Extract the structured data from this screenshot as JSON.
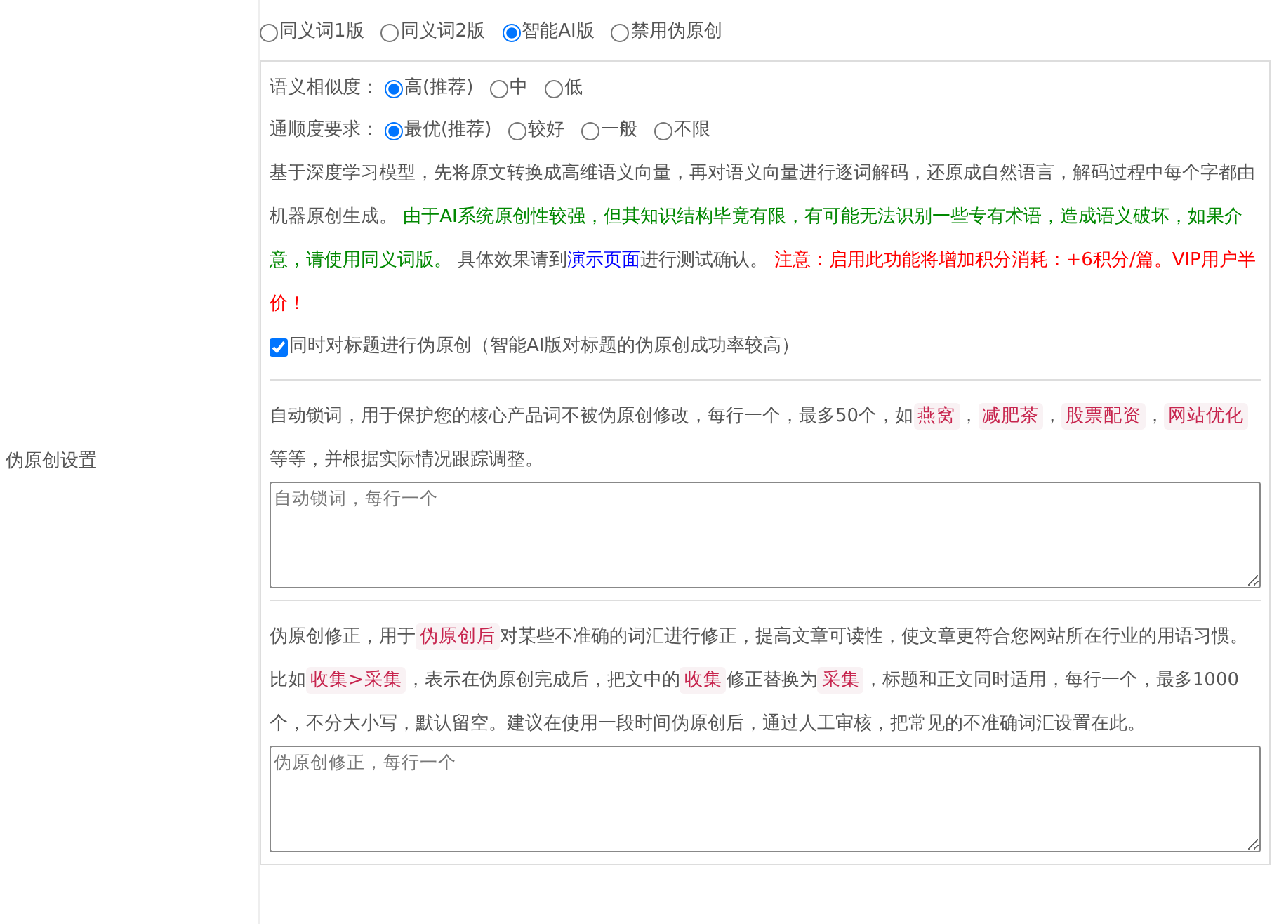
{
  "sidebar": {
    "label": "伪原创设置"
  },
  "modes": [
    {
      "label": "同义词1版",
      "selected": false
    },
    {
      "label": "同义词2版",
      "selected": false
    },
    {
      "label": "智能AI版",
      "selected": true
    },
    {
      "label": "禁用伪原创",
      "selected": false
    }
  ],
  "ai_settings": {
    "similarity": {
      "label": "语义相似度：",
      "options": [
        {
          "label": "高(推荐)",
          "selected": true
        },
        {
          "label": "中",
          "selected": false
        },
        {
          "label": "低",
          "selected": false
        }
      ]
    },
    "fluency": {
      "label": "通顺度要求：",
      "options": [
        {
          "label": "最优(推荐)",
          "selected": true
        },
        {
          "label": "较好",
          "selected": false
        },
        {
          "label": "一般",
          "selected": false
        },
        {
          "label": "不限",
          "selected": false
        }
      ]
    },
    "description": [
      {
        "kind": "plain",
        "text": "基于深度学习模型，先将原文转换成高维语义向量，再对语义向量进行逐词解码，还原成自然语言，解码过程中每个字都由机器原创生成。 "
      },
      {
        "kind": "notice",
        "text": "由于AI系统原创性较强，但其知识结构毕竟有限，有可能无法识别一些专有术语，造成语义破坏，如果介意，请使用同义词版。"
      },
      {
        "kind": "plain",
        "text": " 具体效果请到"
      },
      {
        "kind": "link",
        "text": "演示页面"
      },
      {
        "kind": "plain",
        "text": "进行测试确认。 "
      },
      {
        "kind": "warning",
        "text": "注意：启用此功能将增加积分消耗：+6积分/篇。VIP用户半价！"
      }
    ],
    "title_checkbox": {
      "label": "同时对标题进行伪原创（智能AI版对标题的伪原创成功率较高）",
      "checked": true
    }
  },
  "lock_words": {
    "description": [
      {
        "kind": "plain",
        "text": "自动锁词，用于保护您的核心产品词不被伪原创修改，每行一个，最多50个，如"
      },
      {
        "kind": "code",
        "text": "燕窝"
      },
      {
        "kind": "plain",
        "text": "，"
      },
      {
        "kind": "code",
        "text": "减肥茶"
      },
      {
        "kind": "plain",
        "text": "，"
      },
      {
        "kind": "code",
        "text": "股票配资"
      },
      {
        "kind": "plain",
        "text": "，"
      },
      {
        "kind": "code",
        "text": "网站优化"
      },
      {
        "kind": "plain",
        "text": " 等等，并根据实际情况跟踪调整。"
      }
    ],
    "textarea": {
      "placeholder": "自动锁词，每行一个"
    }
  },
  "corrections": {
    "description": [
      {
        "kind": "plain",
        "text": "伪原创修正，用于"
      },
      {
        "kind": "code",
        "text": "伪原创后"
      },
      {
        "kind": "plain",
        "text": "对某些不准确的词汇进行修正，提高文章可读性，使文章更符合您网站所在行业的用语习惯。比如"
      },
      {
        "kind": "code",
        "text": "收集>采集"
      },
      {
        "kind": "plain",
        "text": "，表示在伪原创完成后，把文中的"
      },
      {
        "kind": "code",
        "text": "收集"
      },
      {
        "kind": "plain",
        "text": "修正替换为"
      },
      {
        "kind": "code",
        "text": "采集"
      },
      {
        "kind": "plain",
        "text": "，标题和正文同时适用，每行一个，最多1000个，不分大小写，默认留空。建议在使用一段时间伪原创后，通过人工审核，把常见的不准确词汇设置在此。"
      }
    ],
    "textarea": {
      "placeholder": "伪原创修正，每行一个"
    }
  }
}
